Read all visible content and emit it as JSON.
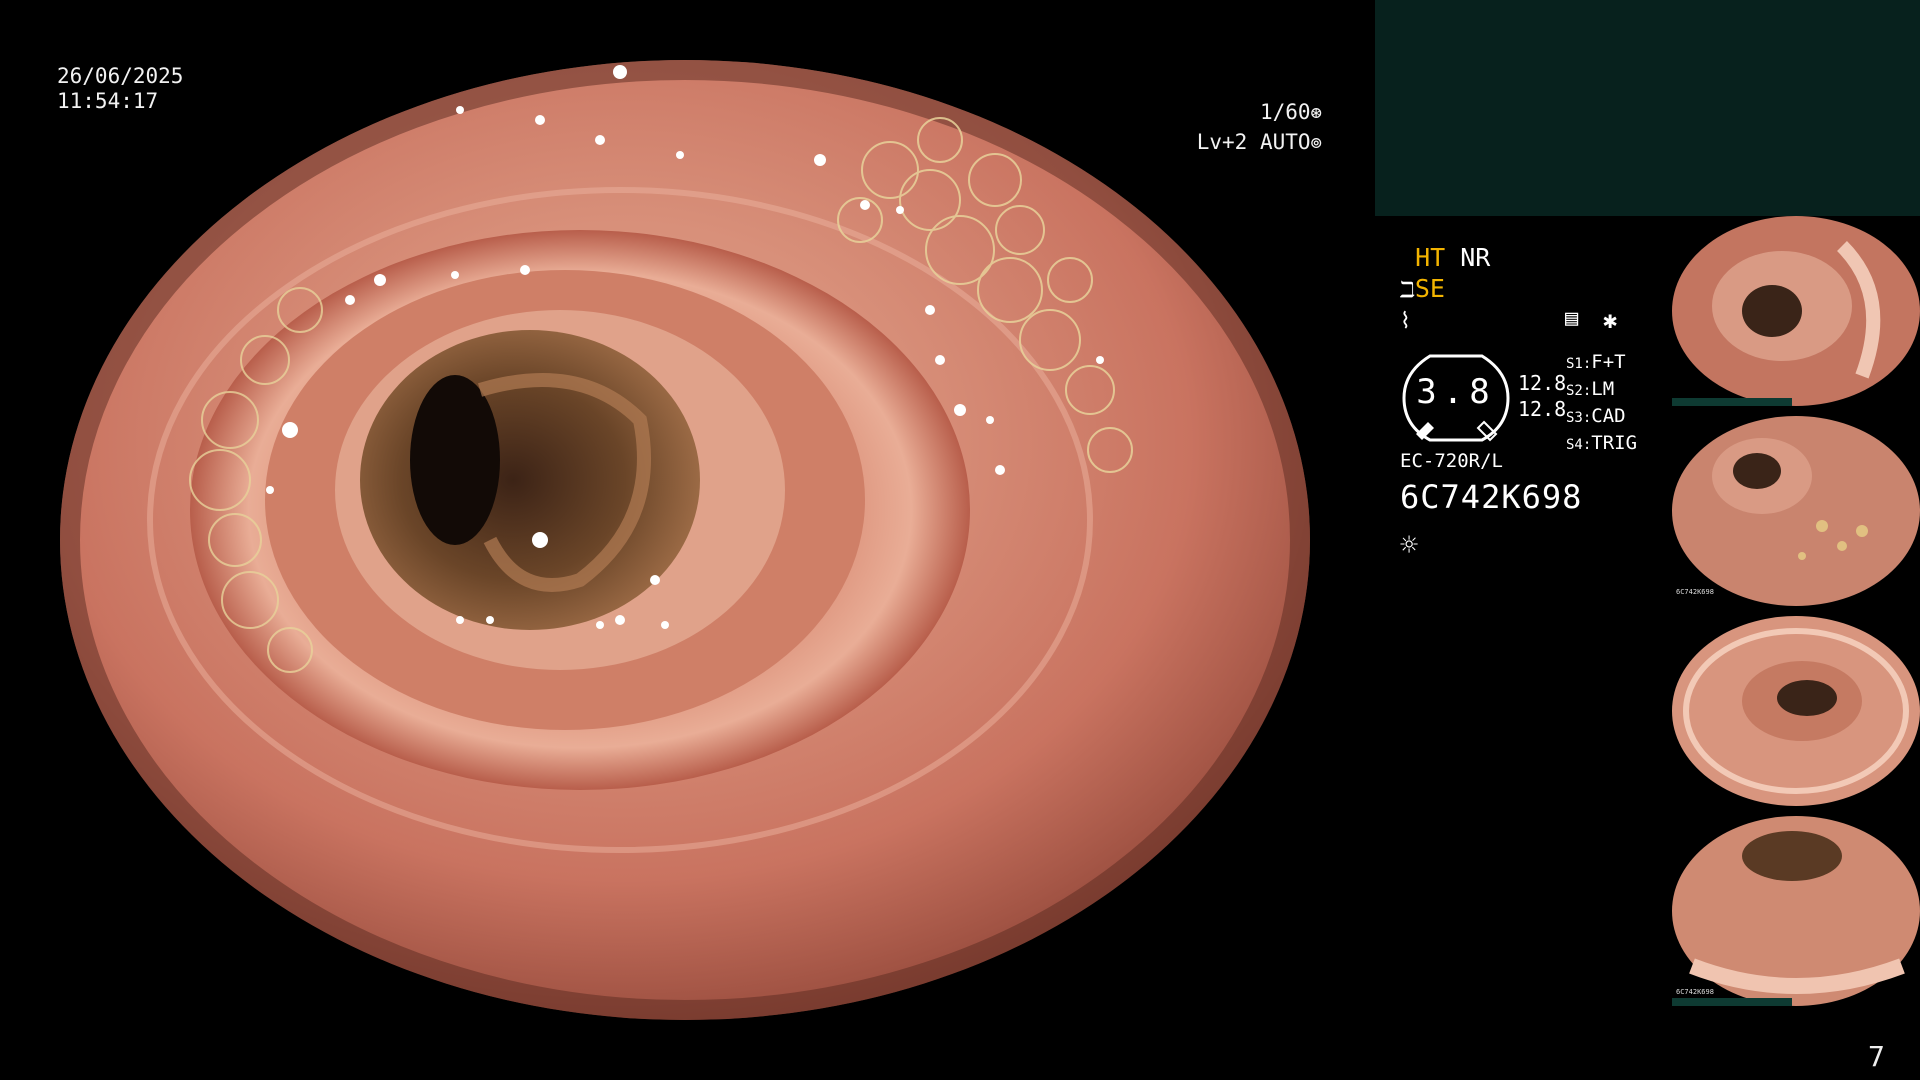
{
  "overlay": {
    "date": "26/06/2025",
    "time": "11:54:17",
    "shutter": "1/60",
    "level": "Lv+2 AUTO"
  },
  "status": {
    "ht": "HT",
    "nr": "NR",
    "se": "SE",
    "gauge_value": "3.8",
    "gauge_num_1": "12.8",
    "gauge_num_2": "12.8",
    "scope_model": "EC-720R/L",
    "serial": "6C742K698",
    "switches": [
      {
        "key": "S1:",
        "value": "F+T"
      },
      {
        "key": "S2:",
        "value": "LM"
      },
      {
        "key": "S3:",
        "value": "CAD"
      },
      {
        "key": "S4:",
        "value": "TRIG"
      }
    ]
  },
  "thumbnails": {
    "label": "6C742K698"
  },
  "page_number": "7",
  "colors": {
    "highlight": "#f3b400",
    "panel": "#07211d",
    "mucosa": "#c8735c"
  }
}
